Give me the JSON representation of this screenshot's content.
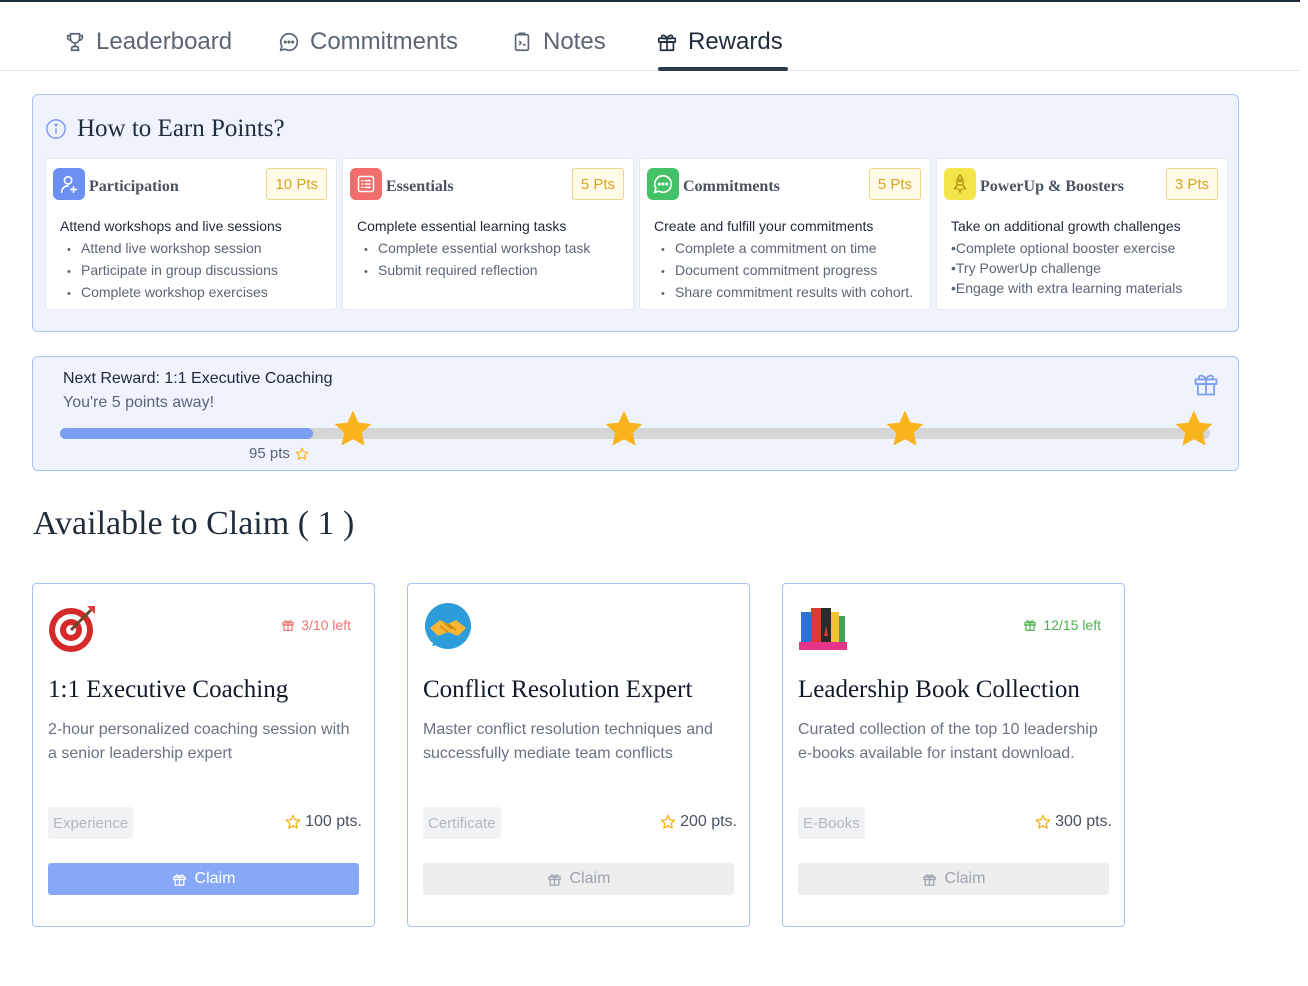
{
  "tabs": [
    {
      "label": "Leaderboard",
      "icon": "trophy-icon"
    },
    {
      "label": "Commitments",
      "icon": "chat-bubble-icon"
    },
    {
      "label": "Notes",
      "icon": "clipboard-icon"
    },
    {
      "label": "Rewards",
      "icon": "gift-icon",
      "active": true
    }
  ],
  "earn": {
    "title": "How to Earn Points?",
    "cards": [
      {
        "name": "Participation",
        "points": "10 Pts",
        "icon": "user-plus-icon",
        "icon_color": "#6c8ff2",
        "desc": "Attend workshops and live sessions",
        "items": [
          "Attend live workshop session",
          "Participate in group discussions",
          "Complete workshop exercises"
        ]
      },
      {
        "name": "Essentials",
        "points": "5 Pts",
        "icon": "list-icon",
        "icon_color": "#f26d6d",
        "desc": "Complete essential learning tasks",
        "items": [
          "Complete essential workshop task",
          "Submit required reflection"
        ]
      },
      {
        "name": "Commitments",
        "points": "5 Pts",
        "icon": "chat-bubble-icon",
        "icon_color": "#45c167",
        "desc": "Create and fulfill your commitments",
        "items": [
          "Complete a commitment on time",
          "Document commitment progress",
          "Share commitment results with cohort."
        ]
      },
      {
        "name": "PowerUp & Boosters",
        "points": "3 Pts",
        "icon": "rocket-icon",
        "icon_color": "#f5e34a",
        "desc": "Take on additional growth challenges",
        "items": [
          "•Complete optional booster exercise",
          "•Try PowerUp challenge",
          "•Engage with extra learning materials"
        ]
      }
    ]
  },
  "next_reward": {
    "title": "Next Reward: 1:1 Executive Coaching",
    "subtitle": "You're 5 points away!",
    "current_points": "95 pts",
    "progress": 0.22,
    "milestones": [
      0.255,
      0.49,
      0.735,
      1.0
    ]
  },
  "available": {
    "heading": "Available to Claim ( 1 )"
  },
  "rewards": [
    {
      "icon": "target-icon",
      "remaining": "3/10 left",
      "remaining_color": "#f27272",
      "title": "1:1 Executive Coaching",
      "desc": "2-hour personalized coaching session with a senior leadership expert",
      "category": "Experience",
      "cost": "100 pts.",
      "claim": "Claim",
      "enabled": true
    },
    {
      "icon": "handshake-icon",
      "remaining": "",
      "remaining_color": "#4caf50",
      "title": "Conflict Resolution Expert",
      "desc": "Master conflict resolution techniques and successfully mediate team conflicts",
      "category": "Certificate",
      "cost": "200 pts.",
      "claim": "Claim",
      "enabled": false
    },
    {
      "icon": "books-icon",
      "remaining": "12/15 left",
      "remaining_color": "#4caf50",
      "title": "Leadership Book Collection",
      "desc": "Curated collection of the top 10 leadership e-books available for instant download.",
      "category": "E-Books",
      "cost": "300 pts.",
      "claim": "Claim",
      "enabled": false
    }
  ],
  "colors": {
    "accent": "#86a8f7",
    "star": "#f9b31c",
    "panel_bg": "#eef3fe",
    "panel_border": "#a9c2f3"
  }
}
